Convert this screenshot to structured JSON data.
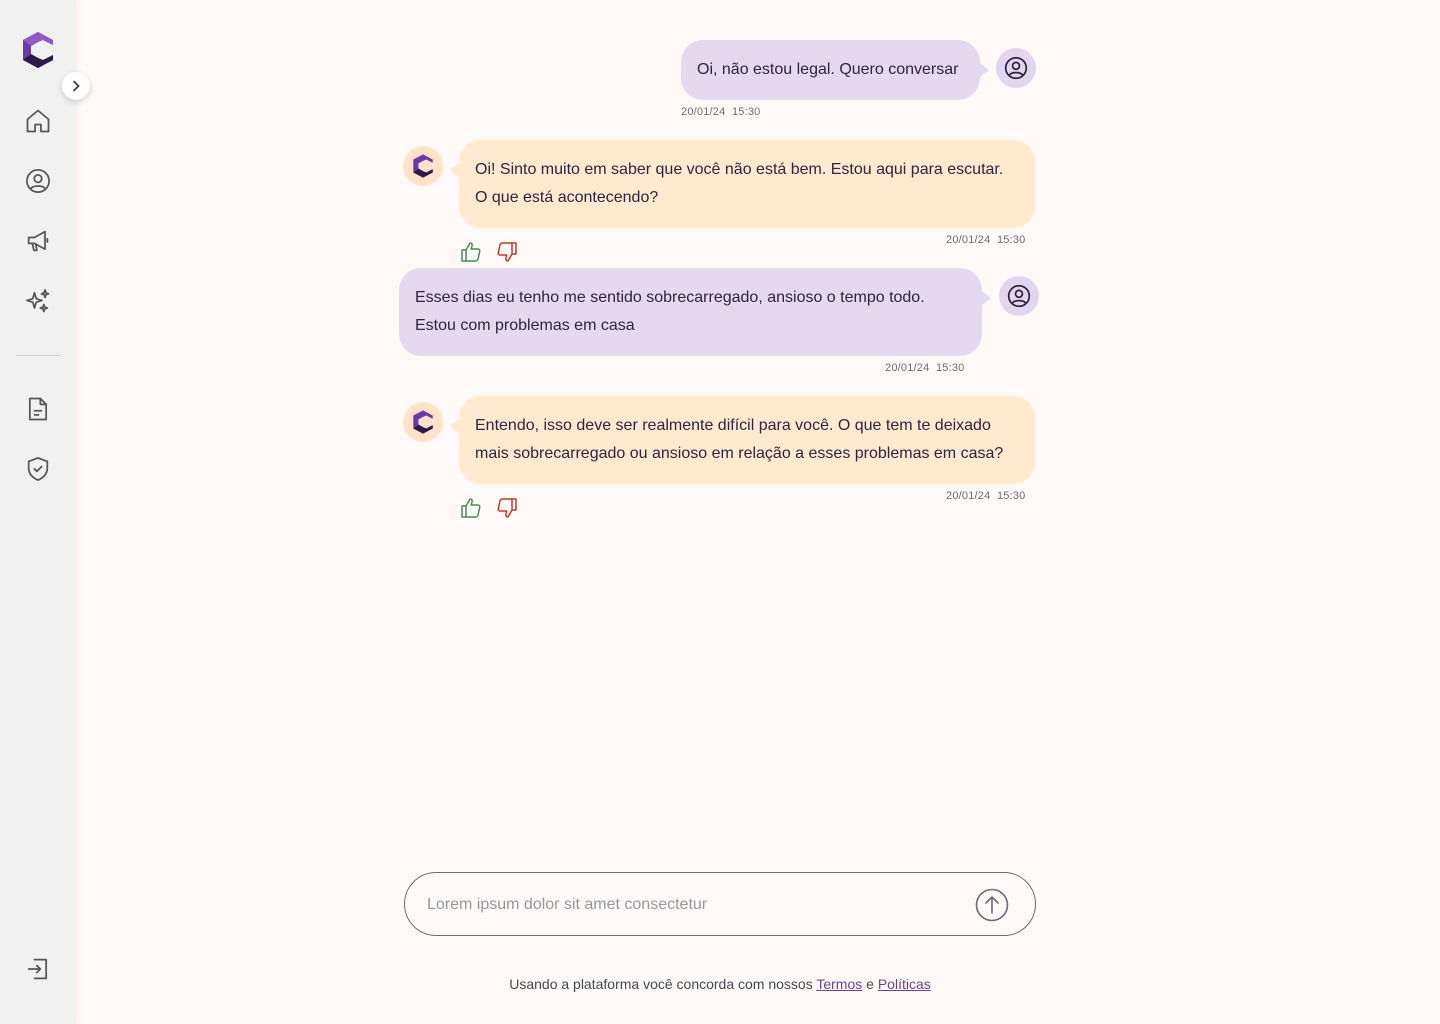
{
  "sidebar": {
    "logo": "logo-c-icon",
    "collapse_icon": "chevron-right-icon",
    "nav": [
      {
        "icon": "home-icon"
      },
      {
        "icon": "user-circle-icon"
      },
      {
        "icon": "megaphone-icon"
      },
      {
        "icon": "sparkles-icon"
      }
    ],
    "secondary": [
      {
        "icon": "document-icon"
      },
      {
        "icon": "shield-check-icon"
      }
    ],
    "logout_icon": "logout-icon"
  },
  "messages": [
    {
      "sender": "user",
      "text": "Oi, não estou legal. Quero conversar",
      "date": "20/01/24",
      "time": "15:30"
    },
    {
      "sender": "bot",
      "text": "Oi! Sinto muito em saber que você não está bem. Estou aqui para escutar. O que está acontecendo?",
      "date": "20/01/24",
      "time": "15:30"
    },
    {
      "sender": "user",
      "text": "Esses dias eu tenho me sentido sobrecarregado, ansioso o tempo todo. Estou com problemas em casa",
      "date": "20/01/24",
      "time": "15:30"
    },
    {
      "sender": "bot",
      "text": "Entendo, isso deve ser realmente difícil para você. O que tem te deixado mais sobrecarregado ou ansioso em relação a esses problemas em casa?",
      "date": "20/01/24",
      "time": "15:30"
    }
  ],
  "composer": {
    "placeholder": "Lorem ipsum dolor sit amet consectetur",
    "value": "",
    "send_icon": "arrow-up-circle-icon"
  },
  "footer": {
    "prefix": "Usando a plataforma você concorda com nossos",
    "terms": "Termos",
    "conjunction": "e",
    "policies": "Políticas"
  },
  "colors": {
    "user_bubble": "#e5d9ef",
    "bot_bubble": "#ffead0",
    "brand_purple": "#5b2d8e",
    "like": "#3f8f5a",
    "dislike": "#c0392b"
  }
}
